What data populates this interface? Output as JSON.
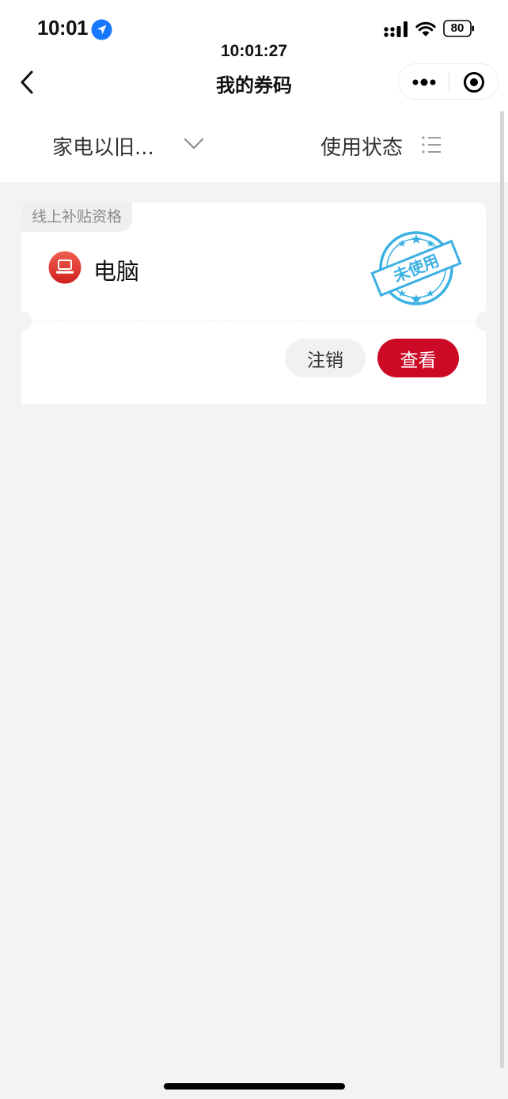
{
  "status_bar": {
    "time": "10:01",
    "battery": "80"
  },
  "header": {
    "clock": "10:01:27",
    "title": "我的券码"
  },
  "filters": {
    "category": "家电以旧...",
    "status": "使用状态"
  },
  "coupon": {
    "tag": "线上补贴资格",
    "product": "电脑",
    "stamp": "未使用",
    "cancel_label": "注销",
    "view_label": "查看"
  },
  "colors": {
    "accent_red": "#cc0a25",
    "stamp_blue": "#3bb0e3",
    "location_blue": "#1677ff"
  },
  "icons": [
    "location-arrow-icon",
    "signal-icon",
    "wifi-icon",
    "battery-icon",
    "back-chevron-icon",
    "more-dots-icon",
    "target-icon",
    "chevron-down-icon",
    "list-icon",
    "laptop-icon"
  ]
}
